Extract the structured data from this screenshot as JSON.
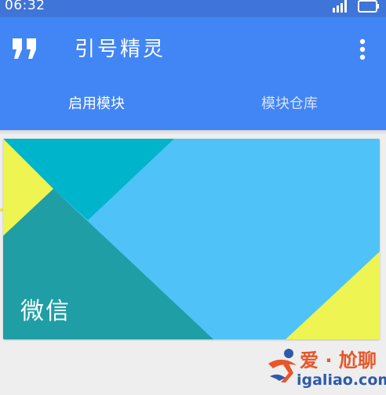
{
  "status_bar": {
    "time": "06:32"
  },
  "app_bar": {
    "title": "引号精灵",
    "logo_icon": "quote-icon",
    "menu_icon": "more-vert-icon"
  },
  "tabs": [
    {
      "label": "启用模块",
      "active": true
    },
    {
      "label": "模块仓库",
      "active": false
    }
  ],
  "modules": [
    {
      "name": "微信"
    }
  ],
  "watermark": {
    "line1": "爱 · 尬聊",
    "line2": "igaliao.com"
  },
  "colors": {
    "app_bar": "#4285f4",
    "status_bar": "#3f74d8",
    "tab_indicator": "#f0e442",
    "card_teal_dark": "#1f9ea6",
    "card_teal": "#00b4cc",
    "card_light_blue": "#4fc3f7",
    "card_yellow": "#eef451"
  }
}
